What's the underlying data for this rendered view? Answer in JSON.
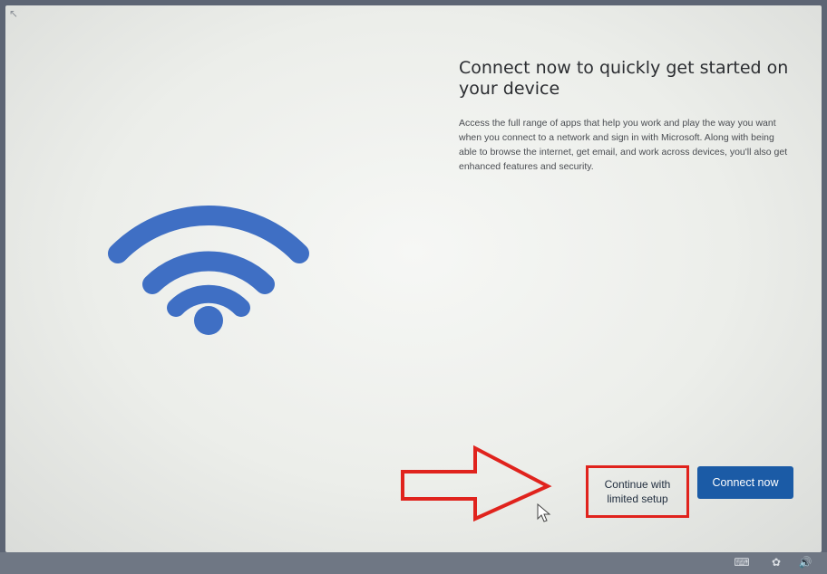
{
  "heading": "Connect now to quickly get started on your device",
  "description": "Access the full range of apps that help you work and play the way you want when you connect to a network and sign in with Microsoft. Along with being able to browse the internet, get email, and work across devices, you'll also get enhanced features and security.",
  "buttons": {
    "continue_limited": "Continue with limited setup",
    "connect_now": "Connect now"
  },
  "icons": {
    "hero": "wifi-icon",
    "annotation": "red-arrow-icon",
    "pointer": "mouse-cursor-icon",
    "tray": [
      "keyboard-icon",
      "accessibility-icon",
      "volume-icon"
    ]
  },
  "colors": {
    "accent": "#1b5ba6",
    "wifi": "#3f6fc4",
    "annotation": "#e0231d"
  }
}
